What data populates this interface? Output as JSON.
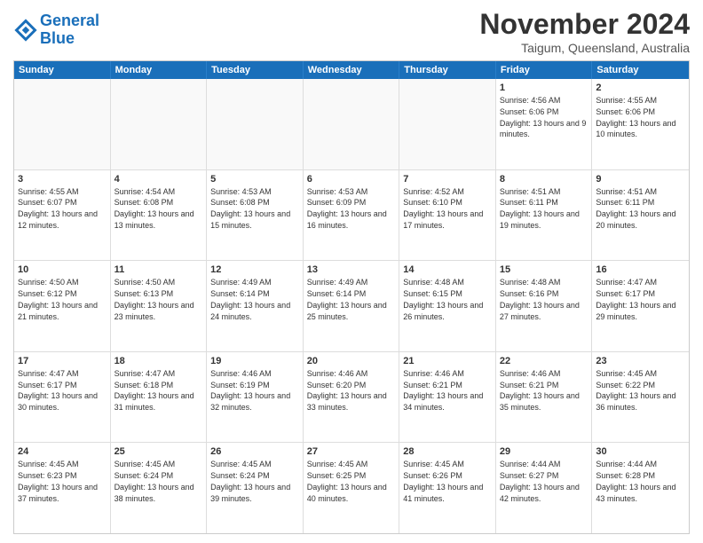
{
  "header": {
    "logo_general": "General",
    "logo_blue": "Blue",
    "month_title": "November 2024",
    "location": "Taigum, Queensland, Australia"
  },
  "days_of_week": [
    "Sunday",
    "Monday",
    "Tuesday",
    "Wednesday",
    "Thursday",
    "Friday",
    "Saturday"
  ],
  "weeks": [
    [
      {
        "day": "",
        "empty": true
      },
      {
        "day": "",
        "empty": true
      },
      {
        "day": "",
        "empty": true
      },
      {
        "day": "",
        "empty": true
      },
      {
        "day": "",
        "empty": true
      },
      {
        "day": "1",
        "sunrise": "Sunrise: 4:56 AM",
        "sunset": "Sunset: 6:06 PM",
        "daylight": "Daylight: 13 hours and 9 minutes."
      },
      {
        "day": "2",
        "sunrise": "Sunrise: 4:55 AM",
        "sunset": "Sunset: 6:06 PM",
        "daylight": "Daylight: 13 hours and 10 minutes."
      }
    ],
    [
      {
        "day": "3",
        "sunrise": "Sunrise: 4:55 AM",
        "sunset": "Sunset: 6:07 PM",
        "daylight": "Daylight: 13 hours and 12 minutes."
      },
      {
        "day": "4",
        "sunrise": "Sunrise: 4:54 AM",
        "sunset": "Sunset: 6:08 PM",
        "daylight": "Daylight: 13 hours and 13 minutes."
      },
      {
        "day": "5",
        "sunrise": "Sunrise: 4:53 AM",
        "sunset": "Sunset: 6:08 PM",
        "daylight": "Daylight: 13 hours and 15 minutes."
      },
      {
        "day": "6",
        "sunrise": "Sunrise: 4:53 AM",
        "sunset": "Sunset: 6:09 PM",
        "daylight": "Daylight: 13 hours and 16 minutes."
      },
      {
        "day": "7",
        "sunrise": "Sunrise: 4:52 AM",
        "sunset": "Sunset: 6:10 PM",
        "daylight": "Daylight: 13 hours and 17 minutes."
      },
      {
        "day": "8",
        "sunrise": "Sunrise: 4:51 AM",
        "sunset": "Sunset: 6:11 PM",
        "daylight": "Daylight: 13 hours and 19 minutes."
      },
      {
        "day": "9",
        "sunrise": "Sunrise: 4:51 AM",
        "sunset": "Sunset: 6:11 PM",
        "daylight": "Daylight: 13 hours and 20 minutes."
      }
    ],
    [
      {
        "day": "10",
        "sunrise": "Sunrise: 4:50 AM",
        "sunset": "Sunset: 6:12 PM",
        "daylight": "Daylight: 13 hours and 21 minutes."
      },
      {
        "day": "11",
        "sunrise": "Sunrise: 4:50 AM",
        "sunset": "Sunset: 6:13 PM",
        "daylight": "Daylight: 13 hours and 23 minutes."
      },
      {
        "day": "12",
        "sunrise": "Sunrise: 4:49 AM",
        "sunset": "Sunset: 6:14 PM",
        "daylight": "Daylight: 13 hours and 24 minutes."
      },
      {
        "day": "13",
        "sunrise": "Sunrise: 4:49 AM",
        "sunset": "Sunset: 6:14 PM",
        "daylight": "Daylight: 13 hours and 25 minutes."
      },
      {
        "day": "14",
        "sunrise": "Sunrise: 4:48 AM",
        "sunset": "Sunset: 6:15 PM",
        "daylight": "Daylight: 13 hours and 26 minutes."
      },
      {
        "day": "15",
        "sunrise": "Sunrise: 4:48 AM",
        "sunset": "Sunset: 6:16 PM",
        "daylight": "Daylight: 13 hours and 27 minutes."
      },
      {
        "day": "16",
        "sunrise": "Sunrise: 4:47 AM",
        "sunset": "Sunset: 6:17 PM",
        "daylight": "Daylight: 13 hours and 29 minutes."
      }
    ],
    [
      {
        "day": "17",
        "sunrise": "Sunrise: 4:47 AM",
        "sunset": "Sunset: 6:17 PM",
        "daylight": "Daylight: 13 hours and 30 minutes."
      },
      {
        "day": "18",
        "sunrise": "Sunrise: 4:47 AM",
        "sunset": "Sunset: 6:18 PM",
        "daylight": "Daylight: 13 hours and 31 minutes."
      },
      {
        "day": "19",
        "sunrise": "Sunrise: 4:46 AM",
        "sunset": "Sunset: 6:19 PM",
        "daylight": "Daylight: 13 hours and 32 minutes."
      },
      {
        "day": "20",
        "sunrise": "Sunrise: 4:46 AM",
        "sunset": "Sunset: 6:20 PM",
        "daylight": "Daylight: 13 hours and 33 minutes."
      },
      {
        "day": "21",
        "sunrise": "Sunrise: 4:46 AM",
        "sunset": "Sunset: 6:21 PM",
        "daylight": "Daylight: 13 hours and 34 minutes."
      },
      {
        "day": "22",
        "sunrise": "Sunrise: 4:46 AM",
        "sunset": "Sunset: 6:21 PM",
        "daylight": "Daylight: 13 hours and 35 minutes."
      },
      {
        "day": "23",
        "sunrise": "Sunrise: 4:45 AM",
        "sunset": "Sunset: 6:22 PM",
        "daylight": "Daylight: 13 hours and 36 minutes."
      }
    ],
    [
      {
        "day": "24",
        "sunrise": "Sunrise: 4:45 AM",
        "sunset": "Sunset: 6:23 PM",
        "daylight": "Daylight: 13 hours and 37 minutes."
      },
      {
        "day": "25",
        "sunrise": "Sunrise: 4:45 AM",
        "sunset": "Sunset: 6:24 PM",
        "daylight": "Daylight: 13 hours and 38 minutes."
      },
      {
        "day": "26",
        "sunrise": "Sunrise: 4:45 AM",
        "sunset": "Sunset: 6:24 PM",
        "daylight": "Daylight: 13 hours and 39 minutes."
      },
      {
        "day": "27",
        "sunrise": "Sunrise: 4:45 AM",
        "sunset": "Sunset: 6:25 PM",
        "daylight": "Daylight: 13 hours and 40 minutes."
      },
      {
        "day": "28",
        "sunrise": "Sunrise: 4:45 AM",
        "sunset": "Sunset: 6:26 PM",
        "daylight": "Daylight: 13 hours and 41 minutes."
      },
      {
        "day": "29",
        "sunrise": "Sunrise: 4:44 AM",
        "sunset": "Sunset: 6:27 PM",
        "daylight": "Daylight: 13 hours and 42 minutes."
      },
      {
        "day": "30",
        "sunrise": "Sunrise: 4:44 AM",
        "sunset": "Sunset: 6:28 PM",
        "daylight": "Daylight: 13 hours and 43 minutes."
      }
    ]
  ]
}
